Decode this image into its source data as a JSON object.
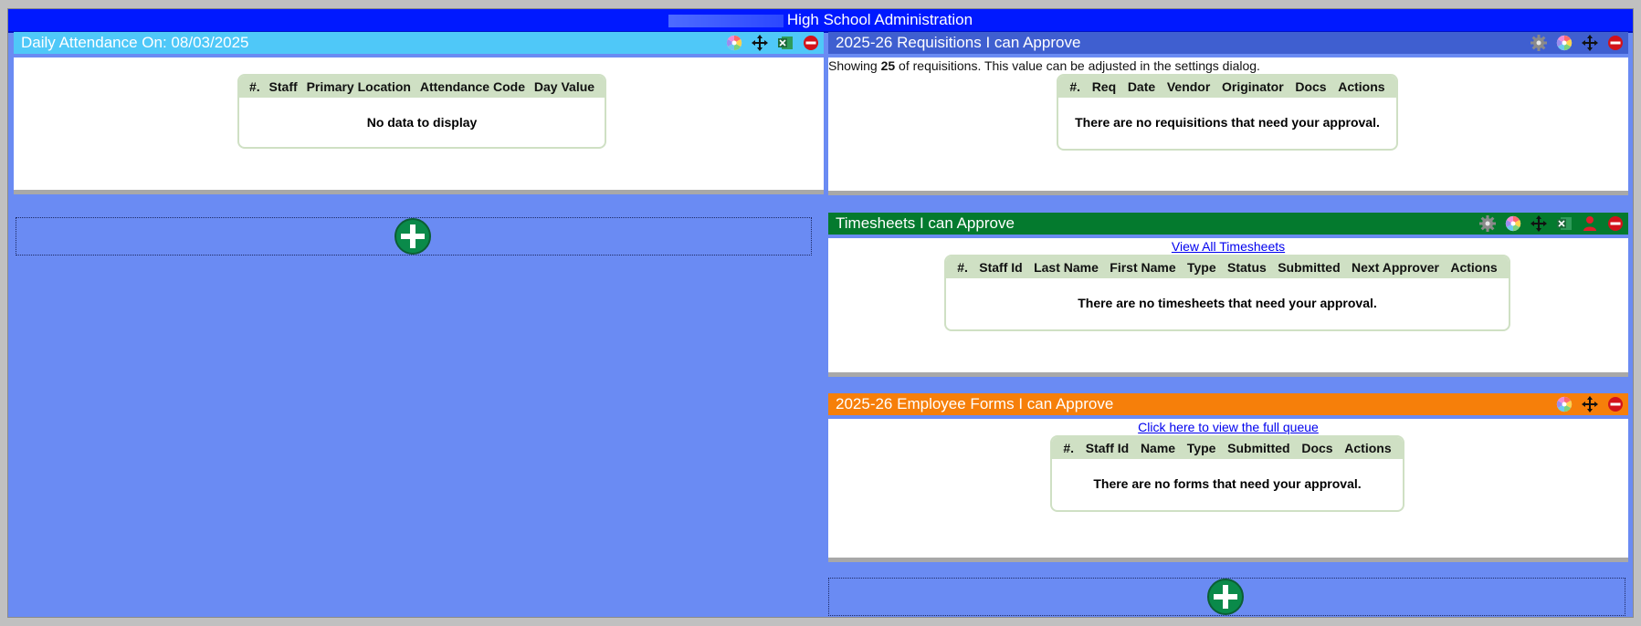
{
  "header": {
    "title": "High School Administration"
  },
  "attendance": {
    "title": "Daily Attendance On: 08/03/2025",
    "columns": [
      "#.",
      "Staff",
      "Primary Location",
      "Attendance Code",
      "Day Value"
    ],
    "empty": "No data to display"
  },
  "requisitions": {
    "title": "2025-26 Requisitions I can Approve",
    "showing_prefix": "Showing ",
    "showing_count": "25",
    "showing_suffix": " of requisitions. This value can be adjusted in the settings dialog.",
    "columns": [
      "#.",
      "Req",
      "Date",
      "Vendor",
      "Originator",
      "Docs",
      "Actions"
    ],
    "empty": "There are no requisitions that need your approval."
  },
  "timesheets": {
    "title": "Timesheets I can Approve",
    "link": "View All Timesheets",
    "columns": [
      "#.",
      "Staff Id",
      "Last Name",
      "First Name",
      "Type",
      "Status",
      "Submitted",
      "Next Approver",
      "Actions"
    ],
    "empty": "There are no timesheets that need your approval."
  },
  "forms": {
    "title": "2025-26 Employee Forms I can Approve",
    "link": "Click here to view the full queue",
    "columns": [
      "#.",
      "Staff Id",
      "Name",
      "Type",
      "Submitted",
      "Docs",
      "Actions"
    ],
    "empty": "There are no forms that need your approval."
  },
  "colors": {
    "topbar": "#0019ff",
    "attendance_header": "#4fc8f8",
    "requisitions_header": "#3f5fd0",
    "timesheets_header": "#047a2e",
    "forms_header": "#f67f0a",
    "grid_header": "#cfe0c4",
    "background": "#6a8bf3"
  },
  "icons": [
    "color-wheel-icon",
    "move-icon",
    "excel-icon",
    "remove-icon",
    "gear-icon",
    "person-icon",
    "add-widget-icon"
  ]
}
